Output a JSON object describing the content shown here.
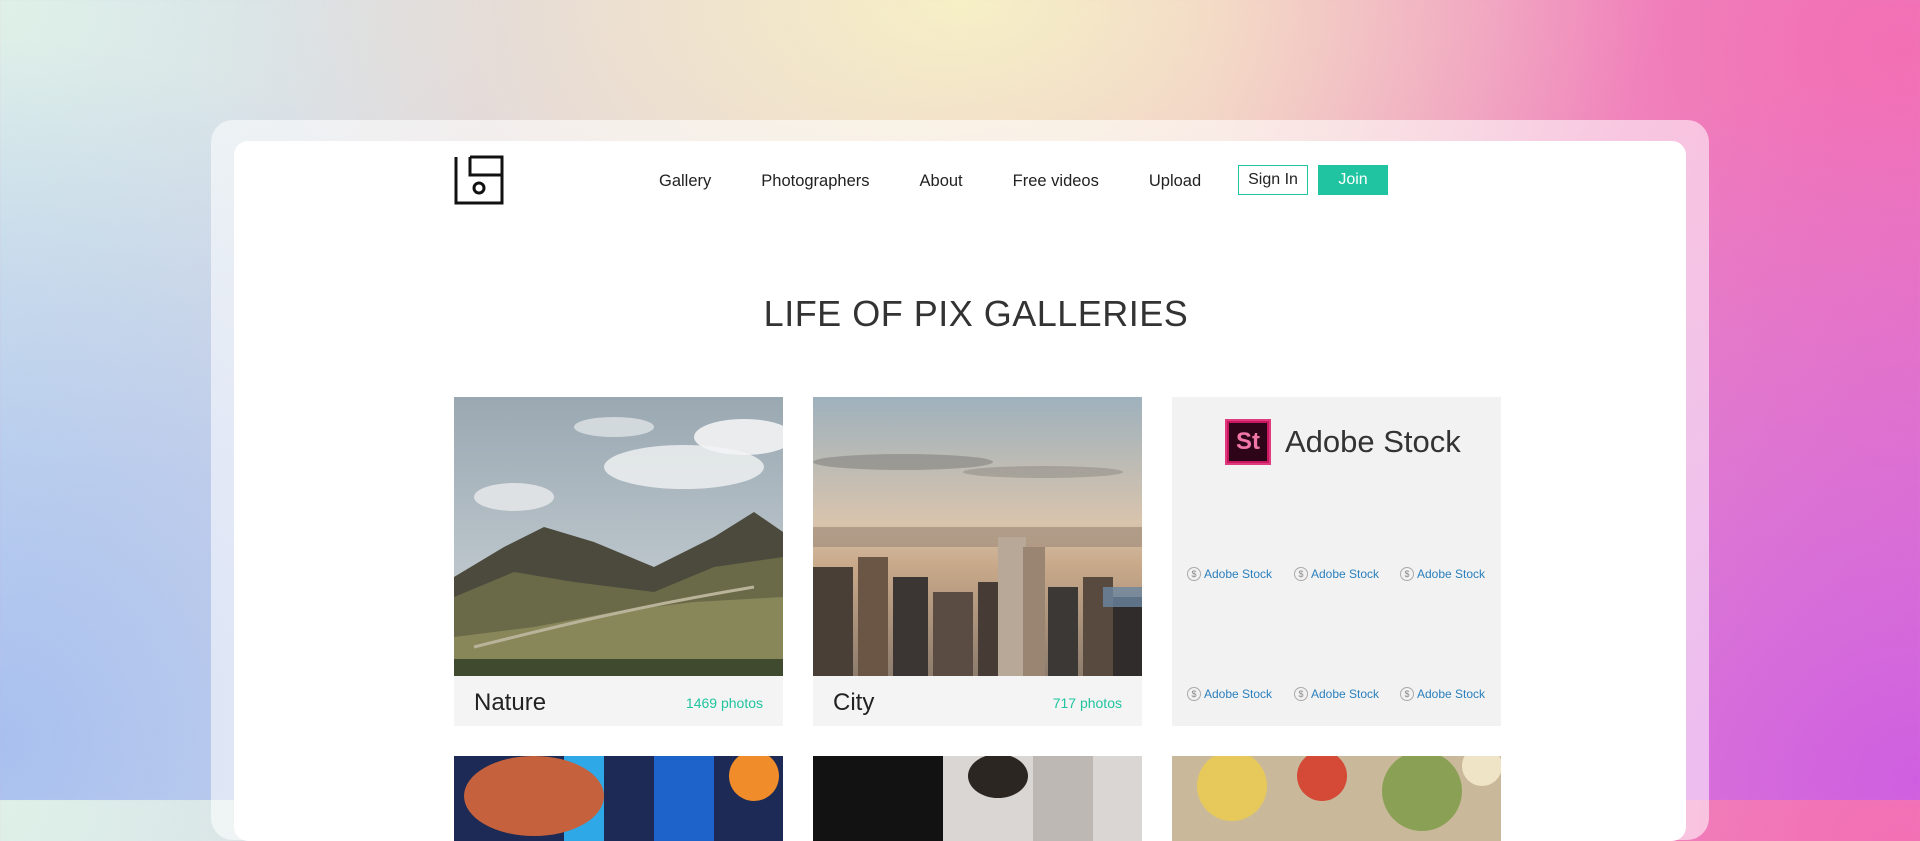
{
  "header": {
    "logo_icon": "camera-frame-logo",
    "nav": [
      "Gallery",
      "Photographers",
      "About",
      "Free videos",
      "Upload"
    ],
    "signin_label": "Sign In",
    "join_label": "Join"
  },
  "page_title": "LIFE OF PIX GALLERIES",
  "galleries": [
    {
      "name": "Nature",
      "count": "1469 photos",
      "image": "mountain-valley-photo"
    },
    {
      "name": "City",
      "count": "717 photos",
      "image": "city-skyline-photo"
    }
  ],
  "ad": {
    "badge": "St",
    "brand": "Adobe Stock",
    "items": [
      "Adobe Stock",
      "Adobe Stock",
      "Adobe Stock",
      "Adobe Stock",
      "Adobe Stock",
      "Adobe Stock"
    ],
    "coin_glyph": "$"
  },
  "colors": {
    "accent": "#20c4a0",
    "link": "#2a7fbd",
    "adobe": "#c6175f"
  }
}
